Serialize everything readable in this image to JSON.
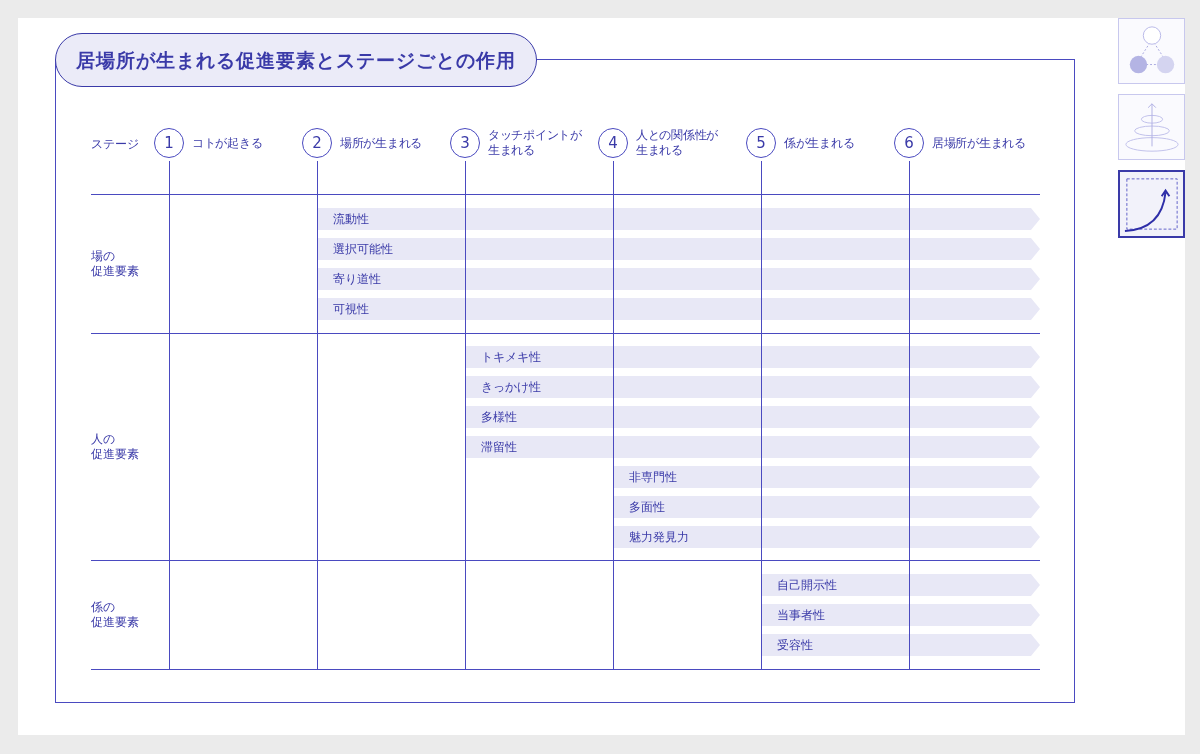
{
  "title": "居場所が生まれる促進要素とステージごとの作用",
  "stage_heading": "ステージ",
  "stages": [
    {
      "number": "1",
      "lines": [
        "コトが起きる"
      ]
    },
    {
      "number": "2",
      "lines": [
        "場所が生まれる"
      ]
    },
    {
      "number": "3",
      "lines": [
        "タッチポイントが",
        "生まれる"
      ]
    },
    {
      "number": "4",
      "lines": [
        "人との関係性が",
        "生まれる"
      ]
    },
    {
      "number": "5",
      "lines": [
        "係が生まれる"
      ]
    },
    {
      "number": "6",
      "lines": [
        "居場所が生まれる"
      ]
    }
  ],
  "groups": [
    {
      "lines": [
        "場の",
        "促進要素"
      ],
      "items": [
        {
          "label": "流動性",
          "kind": "from2"
        },
        {
          "label": "選択可能性",
          "kind": "from2"
        },
        {
          "label": "寄り道性",
          "kind": "from2"
        },
        {
          "label": "可視性",
          "kind": "from2"
        }
      ]
    },
    {
      "lines": [
        "人の",
        "促進要素"
      ],
      "items": [
        {
          "label": "トキメキ性",
          "kind": "from3"
        },
        {
          "label": "きっかけ性",
          "kind": "from3"
        },
        {
          "label": "多様性",
          "kind": "from3"
        },
        {
          "label": "滞留性",
          "kind": "from3"
        },
        {
          "label": "非専門性",
          "kind": "from4"
        },
        {
          "label": "多面性",
          "kind": "from4"
        },
        {
          "label": "魅力発見力",
          "kind": "from4"
        }
      ]
    },
    {
      "lines": [
        "係の",
        "促進要素"
      ],
      "items": [
        {
          "label": "自己開示性",
          "kind": "from5"
        },
        {
          "label": "当事者性",
          "kind": "from5"
        },
        {
          "label": "受容性",
          "kind": "from5"
        }
      ]
    }
  ],
  "thumbnails": [
    {
      "kind": "network",
      "selected": false
    },
    {
      "kind": "spiral",
      "selected": false
    },
    {
      "kind": "growth",
      "selected": true
    }
  ]
}
